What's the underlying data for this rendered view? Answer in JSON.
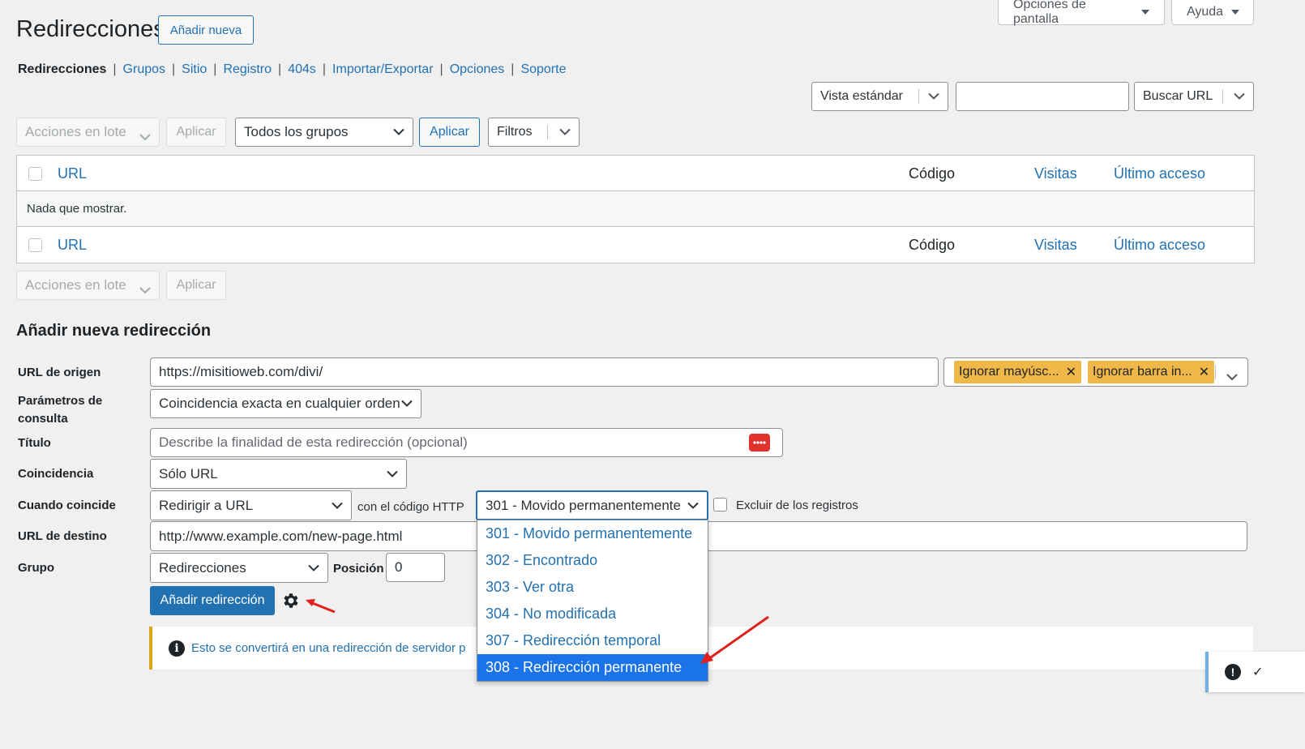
{
  "page": {
    "title": "Redirecciones",
    "add_new": "Añadir nueva",
    "screen_options": "Opciones de pantalla",
    "help": "Ayuda"
  },
  "subnav": {
    "items": [
      {
        "label": "Redirecciones",
        "current": true
      },
      {
        "label": "Grupos"
      },
      {
        "label": "Sitio"
      },
      {
        "label": "Registro"
      },
      {
        "label": "404s"
      },
      {
        "label": "Importar/Exportar"
      },
      {
        "label": "Opciones"
      },
      {
        "label": "Soporte"
      }
    ]
  },
  "search": {
    "view_select": "Vista estándar",
    "search_value": "",
    "search_button": "Buscar URL"
  },
  "top_actions": {
    "bulk": "Acciones en lote",
    "apply": "Aplicar",
    "groups": "Todos los grupos",
    "apply2": "Aplicar",
    "filters": "Filtros"
  },
  "table": {
    "col_url": "URL",
    "col_code": "Código",
    "col_hits": "Visitas",
    "col_last": "Último acceso",
    "empty": "Nada que mostrar."
  },
  "bottom_actions": {
    "bulk": "Acciones en lote",
    "apply": "Aplicar"
  },
  "form": {
    "heading": "Añadir nueva redirección",
    "source_label": "URL de origen",
    "source_value": "https://misitioweb.com/divi/",
    "flags": [
      "Ignorar mayúsc...",
      "Ignorar barra in..."
    ],
    "query_label": "Parámetros de consulta",
    "query_value": "Coincidencia exacta en cualquier orden",
    "title_label": "Título",
    "title_placeholder": "Describe la finalidad de esta redirección (opcional)",
    "match_label": "Coincidencia",
    "match_value": "Sólo URL",
    "when_label": "Cuando coincide",
    "when_value": "Redirigir a URL",
    "http_code_label": "con el código HTTP",
    "http_code_value": "301 - Movido permanentemente",
    "exclude_label": "Excluir de los registros",
    "target_label": "URL de destino",
    "target_value": "http://www.example.com/new-page.html",
    "group_label": "Grupo",
    "group_value": "Redirecciones",
    "position_label": "Posición",
    "position_value": "0",
    "submit": "Añadir redirección",
    "notice": "Esto se convertirá en una redirección de servidor p"
  },
  "http_dropdown": {
    "options": [
      "301 - Movido permanentemente",
      "302 - Encontrado",
      "303 - Ver otra",
      "304 - No modificada",
      "307 - Redirección temporal",
      "308 - Redirección permanente"
    ],
    "selected_index": 5
  },
  "colors": {
    "accent": "#2271b1",
    "highlight": "#1a73e8",
    "tag": "#f0b849",
    "arrow": "#e0201c"
  }
}
